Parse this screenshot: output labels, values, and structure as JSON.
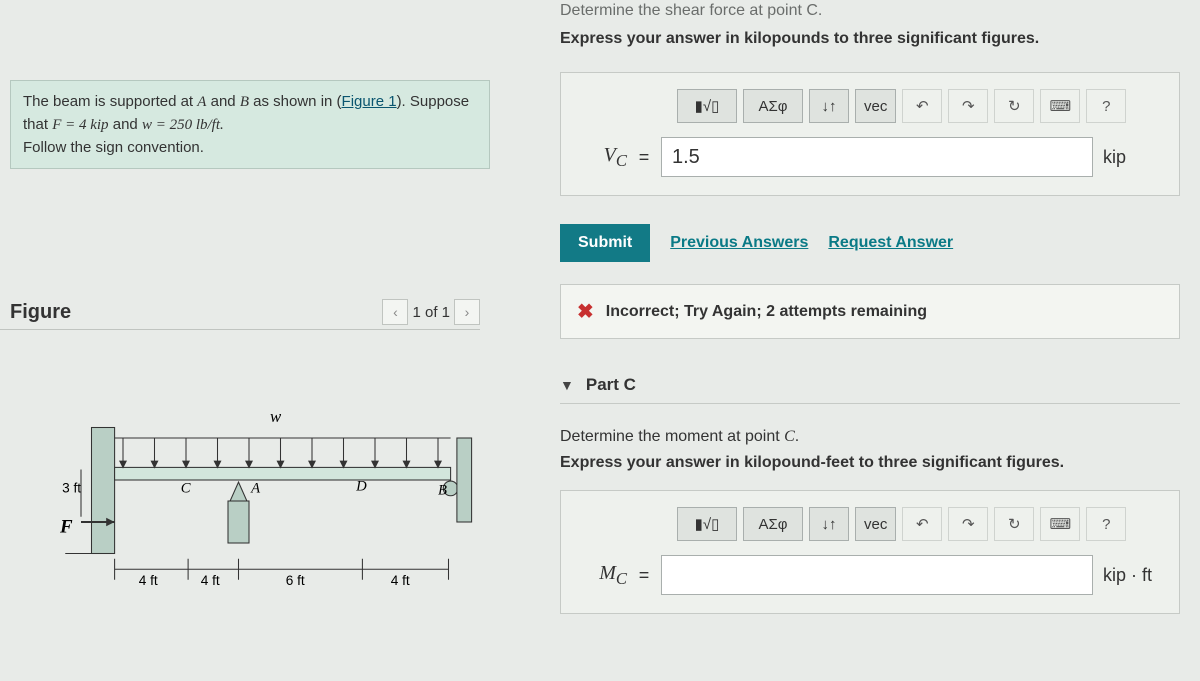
{
  "problem": {
    "text_prefix": "The beam is supported at ",
    "var_A": "A",
    "text_mid1": " and ",
    "var_B": "B",
    "text_mid2": " as shown in (",
    "fig_link": "Figure 1",
    "text_mid3": "). Suppose that ",
    "eq_F": "F = 4 kip",
    "and": " and ",
    "eq_w": "w = 250 lb/ft.",
    "text_end": "Follow the sign convention."
  },
  "figure": {
    "heading": "Figure",
    "nav_prev": "‹",
    "nav_text": "1 of 1",
    "nav_next": "›",
    "labels": {
      "w": "w",
      "F": "F",
      "h": "3 ft",
      "C": "C",
      "A": "A",
      "D": "D",
      "B": "B",
      "d1": "4 ft",
      "d2": "4 ft",
      "d3": "6 ft",
      "d4": "4 ft"
    }
  },
  "partB": {
    "instr1": "Determine the shear force at point C.",
    "instr2": "Express your answer in kilopounds to three significant figures.",
    "toolbar": {
      "templates": "▮√▯",
      "greek": "ΑΣφ",
      "subsup": "↓↑",
      "vec": "vec",
      "undo": "↶",
      "redo": "↷",
      "reset": "↻",
      "keyboard": "⌨",
      "help": "?"
    },
    "var": "V_C",
    "eq": "=",
    "value": "1.5",
    "unit": "kip",
    "submit": "Submit",
    "prev_answers": "Previous Answers",
    "req_answer": "Request Answer",
    "feedback": "Incorrect; Try Again; 2 attempts remaining"
  },
  "partC": {
    "title": "Part C",
    "instr1_pre": "Determine the moment at point ",
    "instr1_var": "C",
    "instr1_post": ".",
    "instr2": "Express your answer in kilopound-feet to three significant figures.",
    "toolbar": {
      "templates": "▮√▯",
      "greek": "ΑΣφ",
      "subsup": "↓↑",
      "vec": "vec",
      "undo": "↶",
      "redo": "↷",
      "reset": "↻",
      "keyboard": "⌨",
      "help": "?"
    },
    "var": "M_C",
    "eq": "=",
    "value": "",
    "unit": "kip · ft"
  }
}
